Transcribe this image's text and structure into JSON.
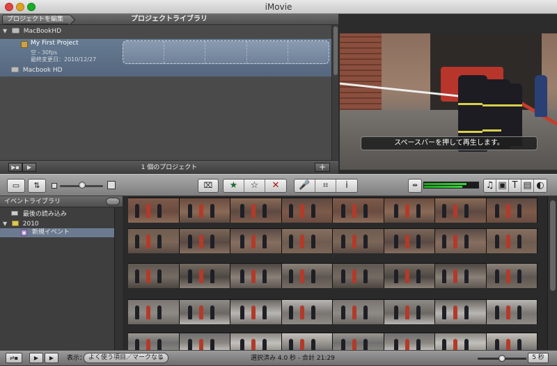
{
  "window": {
    "title": "iMovie"
  },
  "project_pane": {
    "edit_button": "プロジェクトを編集",
    "title": "プロジェクトライブラリ",
    "drives": [
      {
        "label": "MacBookHD",
        "icon": "computer-icon"
      },
      {
        "label": "Macbook HD",
        "icon": "drive-icon"
      }
    ],
    "project": {
      "name": "My First Project",
      "info": "空 - 30fps",
      "modified": "最終変更日：2010/12/27"
    },
    "footer_count": "1 個のプロジェクト",
    "add_label": "+"
  },
  "viewer": {
    "caption": "スペースバーを押して再生します。"
  },
  "toolbar": {
    "camera_icon": "camera-import-icon",
    "rotate_icon": "rotate-icon",
    "favorite": "★",
    "unmark": "☆",
    "reject": "✕",
    "voiceover": "mic-icon",
    "crop": "crop-icon",
    "info": "i",
    "media_buttons": [
      "♫",
      "▣",
      "T",
      "▤",
      "◐"
    ],
    "audio_level_a": 0.78,
    "audio_level_b": 0.71,
    "accent_green": "#1f6b2f"
  },
  "event_pane": {
    "title": "イベントライブラリ",
    "items": [
      {
        "label": "最後の読み込み"
      },
      {
        "label": "2010"
      },
      {
        "label": "新規イベント"
      }
    ]
  },
  "bottombar": {
    "show_label": "表示：",
    "filter_value": "よく使う項目／マークなし",
    "status": "選択済み 4.0 秒 - 合計 21:29",
    "duration": "5 秒"
  }
}
